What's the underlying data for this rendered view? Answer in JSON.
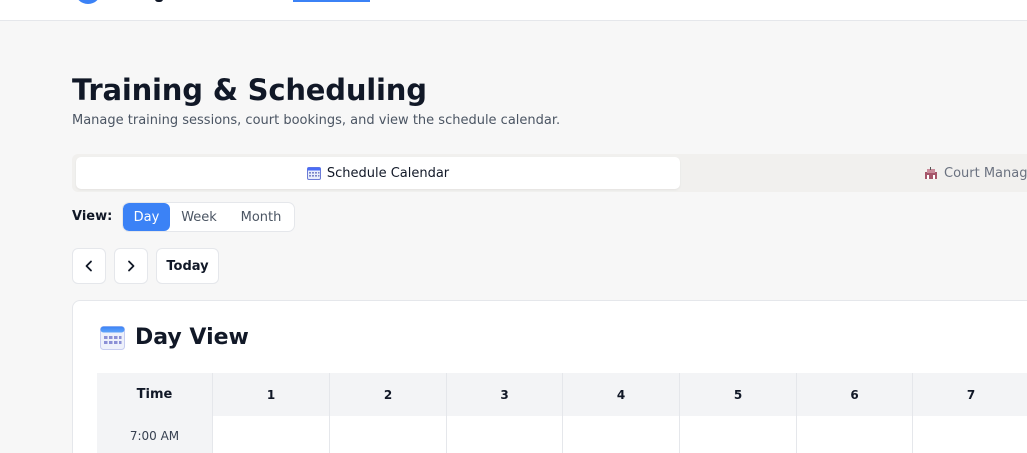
{
  "page": {
    "title": "Training & Scheduling",
    "subtitle": "Manage training sessions, court bookings, and view the schedule calendar."
  },
  "tabs": [
    {
      "label": "Schedule Calendar",
      "icon": "calendar-icon",
      "active": true
    },
    {
      "label": "Court Manag",
      "icon": "stadium-icon",
      "active": false
    }
  ],
  "view": {
    "label": "View:",
    "options": [
      "Day",
      "Week",
      "Month"
    ],
    "selected": "Day"
  },
  "nav": {
    "prev": "‹",
    "next": "›",
    "today": "Today"
  },
  "day_view": {
    "title": "Day View",
    "time_header": "Time",
    "columns": [
      "1",
      "2",
      "3",
      "4",
      "5",
      "6",
      "7"
    ],
    "rows": [
      {
        "time": "7:00 AM"
      }
    ]
  },
  "colors": {
    "accent": "#3b82f6",
    "background": "#f7f7f7",
    "card": "#ffffff",
    "grid_header": "#f3f4f6"
  }
}
